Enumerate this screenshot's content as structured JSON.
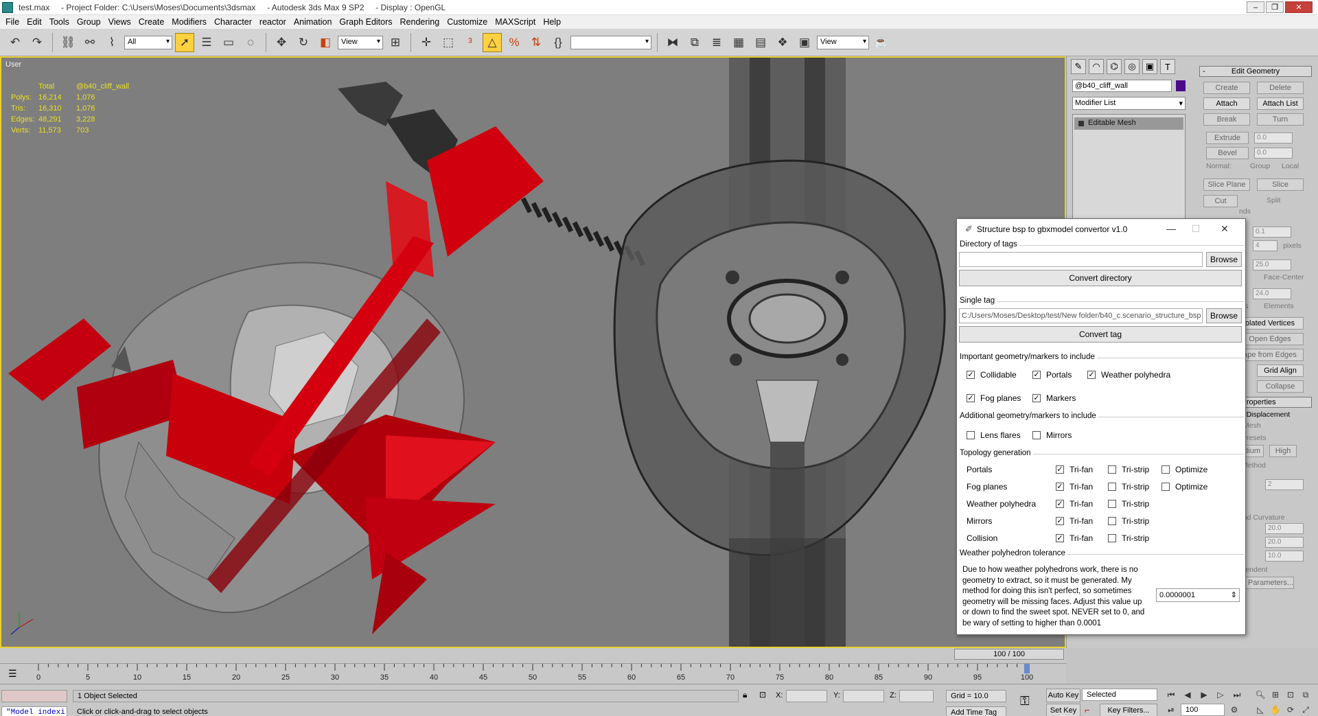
{
  "window": {
    "title": "test.max     - Project Folder: C:\\Users\\Moses\\Documents\\3dsmax     - Autodesk 3ds Max 9 SP2     - Display : OpenGL"
  },
  "menu": [
    "File",
    "Edit",
    "Tools",
    "Group",
    "Views",
    "Create",
    "Modifiers",
    "Character",
    "reactor",
    "Animation",
    "Graph Editors",
    "Rendering",
    "Customize",
    "MAXScript",
    "Help"
  ],
  "toolbar": {
    "filter": "All",
    "ref_coord": "View",
    "named_sel": "",
    "render_view": "View"
  },
  "viewport": {
    "label": "User",
    "stats": {
      "headers": [
        "",
        "Total",
        "@b40_cliff_wall"
      ],
      "rows": [
        {
          "label": "Polys:",
          "total": "16,214",
          "sel": "1,076"
        },
        {
          "label": "Tris:",
          "total": "16,310",
          "sel": "1,076"
        },
        {
          "label": "Edges:",
          "total": "48,291",
          "sel": "3,228"
        },
        {
          "label": "Verts:",
          "total": "11,573",
          "sel": "703"
        }
      ]
    },
    "colors": {
      "background": "#7e7e7e",
      "highlight": "#c8000a",
      "stat_text": "#e8e020",
      "border": "#e8d030"
    }
  },
  "command_panel": {
    "object_name": "@b40_cliff_wall",
    "modifier_list": "Modifier List",
    "stack_item": "Editable Mesh",
    "rollout_title": "Edit Geometry",
    "buttons": {
      "create": "Create",
      "delete": "Delete",
      "attach": "Attach",
      "attach_list": "Attach List",
      "break": "Break",
      "turn": "Turn",
      "extrude": "Extrude",
      "bevel": "Bevel",
      "slice_plane": "Slice Plane",
      "slice": "Slice",
      "cut": "Cut",
      "grid_align": "Grid Align",
      "collapse": "Collapse",
      "open_edges": "Open Edges",
      "high": "High",
      "edium": "edium",
      "key_filters": "Key Filters..."
    },
    "texts": {
      "normal": "Normal:",
      "group": "Group",
      "local": "Local",
      "split": "Split",
      "pixels": "pixels",
      "ends": "nds",
      "face_center": "Face-Center",
      "elements": "Elements",
      "cts": "cts",
      "isolated": "olated Vertices",
      "shape_from_edges": "ape from Edges",
      "properties": "e Properties",
      "displacement": "on Displacement",
      "mesh": "Mesh",
      "presets": "Presets",
      "method": "Method",
      "curvature": "and Curvature",
      "view_dependent": "View-Dependent",
      "advanced": "Advanced Parameters..."
    },
    "spinners": {
      "extrude": "0.0",
      "bevel": "0.0",
      "a": "0.1",
      "b": "4",
      "c": "25.0",
      "d": "24.0",
      "e": "2",
      "f": "20.0",
      "g": "20.0",
      "h": "10.0"
    }
  },
  "dialog": {
    "title": "Structure bsp to gbxmodel convertor v1.0",
    "dir_group": "Directory of tags",
    "dir_value": "",
    "browse": "Browse",
    "convert_dir": "Convert directory",
    "single_group": "Single tag",
    "single_value": "C:/Users/Moses/Desktop/test/New folder/b40_c.scenario_structure_bsp",
    "convert_tag": "Convert tag",
    "important_group": "Important geometry/markers to include",
    "important": [
      {
        "label": "Collidable",
        "checked": true
      },
      {
        "label": "Portals",
        "checked": true
      },
      {
        "label": "Weather polyhedra",
        "checked": true
      },
      {
        "label": "Fog planes",
        "checked": true
      },
      {
        "label": "Markers",
        "checked": true
      }
    ],
    "additional_group": "Additional geometry/markers to include",
    "additional": [
      {
        "label": "Lens flares",
        "checked": false
      },
      {
        "label": "Mirrors",
        "checked": false
      }
    ],
    "topology_group": "Topology generation",
    "topology": [
      {
        "label": "Portals",
        "trifan": true,
        "tristrip": false,
        "optimize": false
      },
      {
        "label": "Fog planes",
        "trifan": true,
        "tristrip": false,
        "optimize": false
      },
      {
        "label": "Weather polyhedra",
        "trifan": true,
        "tristrip": false
      },
      {
        "label": "Mirrors",
        "trifan": true,
        "tristrip": false
      },
      {
        "label": "Collision",
        "trifan": true,
        "tristrip": false
      }
    ],
    "trifan": "Tri-fan",
    "tristrip": "Tri-strip",
    "optimize": "Optimize",
    "tolerance_group": "Weather polyhedron tolerance",
    "tolerance_desc": "Due to how weather polyhedrons work, there is no geometry to extract, so it must be generated. My method for doing this isn't perfect, so sometimes geometry will be missing faces. Adjust this value up or down to find the sweet spot. NEVER set to 0, and be wary of setting to higher than 0.0001",
    "tolerance_value": "0.0000001"
  },
  "timeline": {
    "slider": "100 / 100",
    "ticks": [
      0,
      5,
      10,
      15,
      20,
      25,
      30,
      35,
      40,
      45,
      50,
      55,
      60,
      65,
      70,
      75,
      80,
      85,
      90,
      95,
      100
    ]
  },
  "status": {
    "maxscript": "\"Model indexi",
    "selection": "1 Object Selected",
    "prompt": "Click or click-and-drag to select objects",
    "x_label": "X:",
    "y_label": "Y:",
    "z_label": "Z:",
    "grid": "Grid = 10.0",
    "add_time_tag": "Add Time Tag",
    "auto_key": "Auto Key",
    "set_key": "Set Key",
    "selected": "Selected",
    "frame": "100"
  }
}
